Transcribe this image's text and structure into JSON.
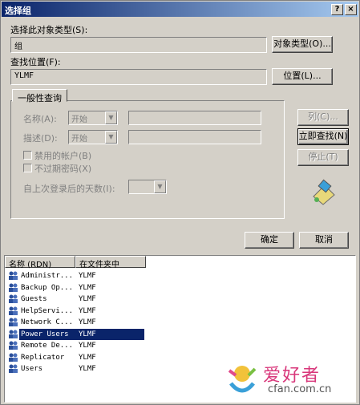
{
  "window": {
    "title": "选择组",
    "help": "?",
    "close": "×"
  },
  "object_type": {
    "label": "选择此对象类型(S):",
    "value": "组",
    "button": "对象类型(O)..."
  },
  "location": {
    "label": "查找位置(F):",
    "value": "YLMF",
    "button": "位置(L)..."
  },
  "tab": "一般性查询",
  "query": {
    "name_label": "名称(A):",
    "name_combo": "开始",
    "desc_label": "描述(D):",
    "desc_combo": "开始",
    "disabled_accounts": "禁用的帐户(B)",
    "no_expire_pwd": "不过期密码(X)",
    "days_label": "自上次登录后的天数(I):"
  },
  "side_buttons": {
    "columns": "列(C)...",
    "find_now": "立即查找(N)",
    "stop": "停止(T)"
  },
  "ok": "确定",
  "cancel": "取消",
  "list": {
    "headers": [
      "名称 (RDN)",
      "在文件夹中"
    ],
    "rows": [
      {
        "name": "Administr...",
        "folder": "YLMF"
      },
      {
        "name": "Backup Op...",
        "folder": "YLMF"
      },
      {
        "name": "Guests",
        "folder": "YLMF"
      },
      {
        "name": "HelpServi...",
        "folder": "YLMF"
      },
      {
        "name": "Network C...",
        "folder": "YLMF"
      },
      {
        "name": "Power Users",
        "folder": "YLMF"
      },
      {
        "name": "Remote De...",
        "folder": "YLMF"
      },
      {
        "name": "Replicator",
        "folder": "YLMF"
      },
      {
        "name": "Users",
        "folder": "YLMF"
      }
    ],
    "selected_index": 5
  },
  "watermark": {
    "brand": "爱好者",
    "site": "cfan.com.cn"
  }
}
